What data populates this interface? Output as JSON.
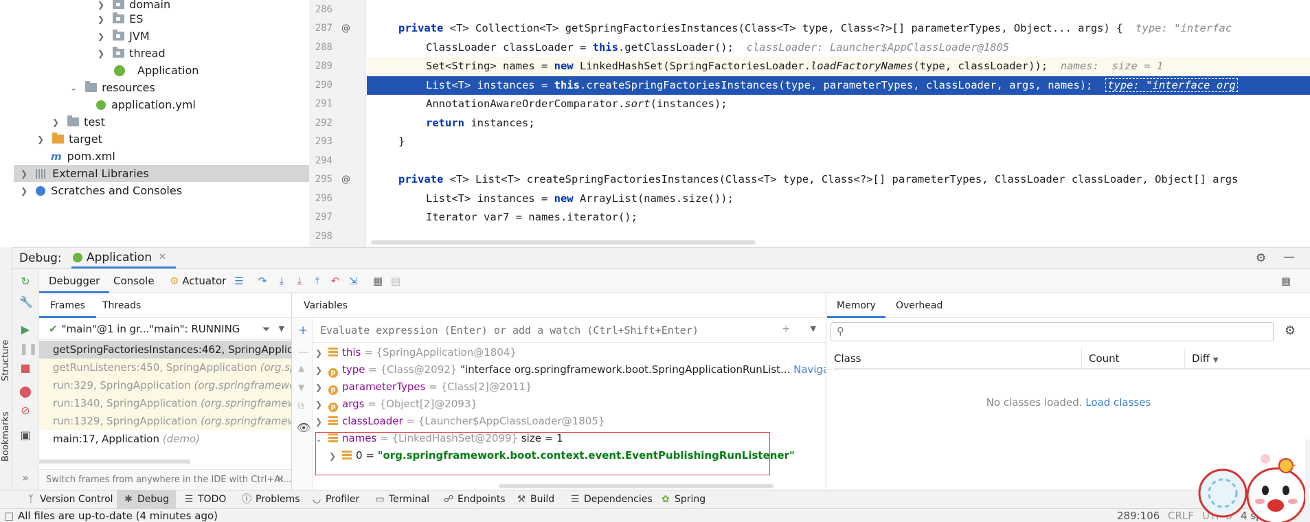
{
  "project_tree": {
    "items": [
      {
        "label": "domain",
        "kind": "package"
      },
      {
        "label": "ES",
        "kind": "package"
      },
      {
        "label": "JVM",
        "kind": "package"
      },
      {
        "label": "thread",
        "kind": "package"
      },
      {
        "label": "Application",
        "kind": "spring-class"
      },
      {
        "label": "resources",
        "kind": "folder"
      },
      {
        "label": "application.yml",
        "kind": "spring-file"
      },
      {
        "label": "test",
        "kind": "folder"
      },
      {
        "label": "target",
        "kind": "folder-orange"
      },
      {
        "label": "pom.xml",
        "kind": "maven"
      },
      {
        "label": "External Libraries",
        "kind": "library"
      },
      {
        "label": "Scratches and Consoles",
        "kind": "scratch"
      }
    ]
  },
  "editor": {
    "line_numbers": [
      "286",
      "287",
      "288",
      "289",
      "290",
      "291",
      "292",
      "293",
      "294",
      "295",
      "296",
      "297",
      "298"
    ],
    "lines": {
      "l287_a": "private ",
      "l287_b": "<T> Collection<T> getSpringFactoriesInstances(Class<T> type, Class<?>[] parameterTypes, Object... args) {",
      "l287_hint": "type: \"interfac",
      "l288": "ClassLoader classLoader = ",
      "l288_this": "this",
      "l288_b": ".getClassLoader();",
      "l288_hint": "classLoader: Launcher$AppClassLoader@1805",
      "l289_a": "Set<String> names = ",
      "l289_new": "new",
      "l289_b": " LinkedHashSet(SpringFactoriesLoader.",
      "l289_it": "loadFactoryNames",
      "l289_c": "(type, classLoader));",
      "l289_hint": "names:  size = 1",
      "l290_a": "List<T> instances = ",
      "l290_this": "this",
      "l290_b": ".createSpringFactoriesInstances(type, parameterTypes, classLoader, args, names);",
      "l290_hint": "type: \"interface org",
      "l291_a": "AnnotationAwareOrderComparator.",
      "l291_it": "sort",
      "l291_b": "(instances);",
      "l292_kw": "return",
      "l292_b": " instances;",
      "l293": "}",
      "l295_a": "private ",
      "l295_b": "<T> List<T> createSpringFactoriesInstances(Class<T> type, Class<?>[] parameterTypes, ClassLoader classLoader, Object[] args",
      "l296_a": "List<T> instances = ",
      "l296_new": "new",
      "l296_b": " ArrayList(names.size());",
      "l297": "Iterator var7 = names.iterator();"
    }
  },
  "debug": {
    "label": "Debug:",
    "session_tab": "Application",
    "tabs": {
      "debugger": "Debugger",
      "console": "Console",
      "actuator": "Actuator"
    },
    "frames_tab": "Frames",
    "threads_tab": "Threads",
    "thread": "\"main\"@1 in gr...\"main\": RUNNING",
    "frames": [
      {
        "method": "getSpringFactoriesInstances:462, SpringApplica",
        "pkg": ""
      },
      {
        "method": "getRunListeners:450, SpringApplication ",
        "pkg": "(org.sp"
      },
      {
        "method": "run:329, SpringApplication ",
        "pkg": "(org.springframewo"
      },
      {
        "method": "run:1340, SpringApplication ",
        "pkg": "(org.springframewo"
      },
      {
        "method": "run:1329, SpringApplication ",
        "pkg": "(org.springframewo"
      },
      {
        "method": "main:17, Application ",
        "pkg": "(demo)"
      }
    ],
    "frames_tip": "Switch frames from anywhere in the IDE with Ctrl+Al...",
    "variables_title": "Variables",
    "eval_placeholder": "Evaluate expression (Enter) or add a watch (Ctrl+Shift+Enter)",
    "variables": [
      {
        "name": "this",
        "type": " = {SpringApplication@1804}",
        "extra": "",
        "icon": "field"
      },
      {
        "name": "type",
        "type": " = {Class@2092} ",
        "extra": "\"interface org.springframework.boot.SpringApplicationRunList...",
        "nav": " Navigate",
        "icon": "param"
      },
      {
        "name": "parameterTypes",
        "type": " = {Class[2]@2011}",
        "extra": "",
        "icon": "param"
      },
      {
        "name": "args",
        "type": " = {Object[2]@2093}",
        "extra": "",
        "icon": "param"
      },
      {
        "name": "classLoader",
        "type": " = {Launcher$AppClassLoader@1805}",
        "extra": "",
        "icon": "field"
      },
      {
        "name": "names",
        "type": " = {LinkedHashSet@2099}",
        "extra": "  size = 1",
        "icon": "field"
      },
      {
        "name": "0",
        "type": " = ",
        "extra": "\"org.springframework.boot.context.event.EventPublishingRunListener\"",
        "icon": "field"
      }
    ],
    "memory_tab": "Memory",
    "overhead_tab": "Overhead",
    "memory_cols": {
      "class": "Class",
      "count": "Count",
      "diff": "Diff"
    },
    "memory_empty": "No classes loaded. ",
    "memory_load": "Load classes"
  },
  "side_labels": {
    "structure": "Structure",
    "bookmarks": "Bookmarks"
  },
  "bottom_tabs": [
    "Version Control",
    "Debug",
    "TODO",
    "Problems",
    "Profiler",
    "Terminal",
    "Endpoints",
    "Build",
    "Dependencies",
    "Spring"
  ],
  "status": {
    "message": "All files are up-to-date (4 minutes ago)",
    "position": "289:106",
    "line_sep": "CRLF",
    "encoding": "UTF-8",
    "indent": "4 sp"
  },
  "colors": {
    "accent": "#3b7fd4",
    "exec_line": "#2154b3",
    "keyword": "#0033b3",
    "string": "#067d17",
    "highlight_box": "#e04848"
  }
}
